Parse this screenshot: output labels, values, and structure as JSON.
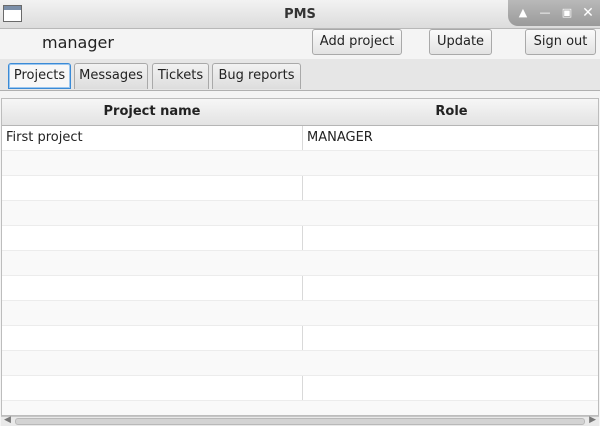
{
  "window": {
    "title": "PMS",
    "controls": [
      "up-icon",
      "minimize-icon",
      "maximize-icon",
      "close-icon"
    ]
  },
  "toolbar": {
    "user": "manager",
    "add_project_label": "Add project",
    "update_label": "Update",
    "sign_out_label": "Sign out"
  },
  "tabs": [
    {
      "label": "Projects",
      "active": true
    },
    {
      "label": "Messages",
      "active": false
    },
    {
      "label": "Tickets",
      "active": false
    },
    {
      "label": "Bug reports",
      "active": false
    }
  ],
  "table": {
    "columns": [
      "Project name",
      "Role"
    ],
    "rows": [
      [
        "First project",
        "MANAGER"
      ]
    ]
  },
  "colors": {
    "active_tab_border": "#3a8ad6"
  }
}
